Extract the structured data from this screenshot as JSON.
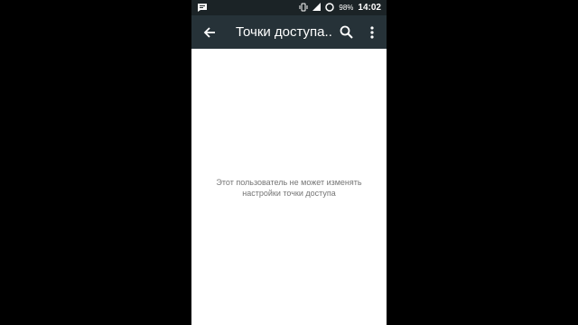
{
  "status_bar": {
    "notification_icon": "chat-bubble-icon",
    "battery_percent": "98%",
    "time": "14:02"
  },
  "toolbar": {
    "title": "Точки доступа...",
    "back_icon": "arrow-back-icon",
    "search_icon": "search-icon",
    "more_icon": "more-vert-icon"
  },
  "content": {
    "message_line1": "Этот пользователь не может изменять",
    "message_line2": "настройки точки доступа"
  },
  "colors": {
    "status_bar_bg": "#1b2326",
    "toolbar_bg": "#263238",
    "content_bg": "#ffffff",
    "message_text": "#757575"
  }
}
